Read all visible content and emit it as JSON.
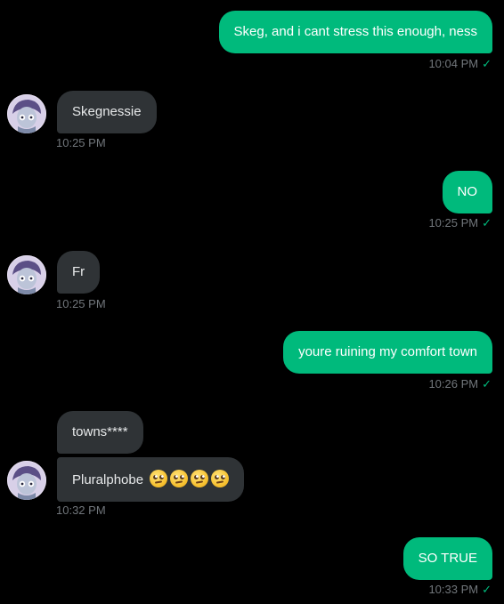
{
  "messages": [
    {
      "side": "out",
      "text": "Skeg, and i cant stress this enough, ness",
      "time": "10:04 PM"
    },
    {
      "side": "in",
      "text": "Skegnessie",
      "time": "10:25 PM"
    },
    {
      "side": "out",
      "text": "NO",
      "time": "10:25 PM"
    },
    {
      "side": "in",
      "text": "Fr",
      "time": "10:25 PM"
    },
    {
      "side": "out",
      "text": "youre ruining my comfort town",
      "time": "10:26 PM"
    },
    {
      "side": "in",
      "text": "towns****",
      "time": ""
    },
    {
      "side": "in",
      "text": "Pluralphobe",
      "emoji": "face-with-rolling-eyes-icon x4",
      "time": "10:32 PM"
    },
    {
      "side": "out",
      "text": "SO TRUE",
      "time": "10:33 PM"
    }
  ],
  "icons": {
    "read_receipt": "checkmark-icon",
    "avatar": "avatar"
  },
  "colors": {
    "background": "#000000",
    "outgoing_bubble": "#00ba7c",
    "incoming_bubble": "#2f3336",
    "timestamp": "#71767b",
    "checkmark": "#00ba7c"
  }
}
